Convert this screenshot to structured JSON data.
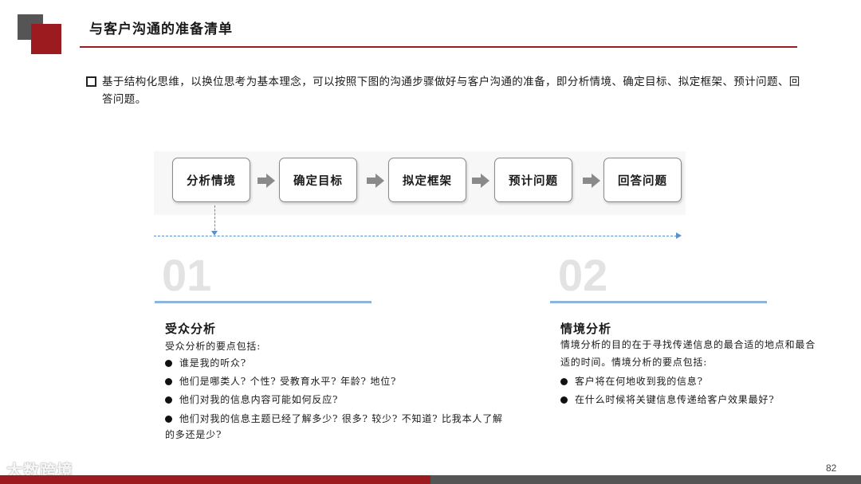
{
  "header": {
    "title": "与客户沟通的准备清单"
  },
  "intro": {
    "text": "基于结构化思维，以换位思考为基本理念，可以按照下图的沟通步骤做好与客户沟通的准备，即分析情境、确定目标、拟定框架、预计问题、回答问题。"
  },
  "flow": {
    "steps": [
      "分析情境",
      "确定目标",
      "拟定框架",
      "预计问题",
      "回答问题"
    ]
  },
  "section1": {
    "number": "01",
    "title": "受众分析",
    "intro": "受众分析的要点包括:",
    "items": [
      "谁是我的听众?",
      "他们是哪类人? 个性? 受教育水平? 年龄? 地位?",
      "他们对我的信息内容可能如何反应?",
      "他们对我的信息主题已经了解多少? 很多? 较少? 不知道?  比我本人了解的多还是少?"
    ]
  },
  "section2": {
    "number": "02",
    "title": "情境分析",
    "intro": "情境分析的目的在于寻找传递信息的最合适的地点和最合适的时间。情境分析的要点包括:",
    "items": [
      "客户将在何地收到我的信息?",
      "在什么时候将关键信息传递给客户效果最好?"
    ]
  },
  "footer": {
    "page_number": "82",
    "watermark": "大数跨境"
  },
  "colors": {
    "accent_red": "#9b1b1e",
    "dark_grey": "#555555",
    "flow_line_blue": "#5b8fc9",
    "section_rule_blue": "#8fb4db"
  }
}
